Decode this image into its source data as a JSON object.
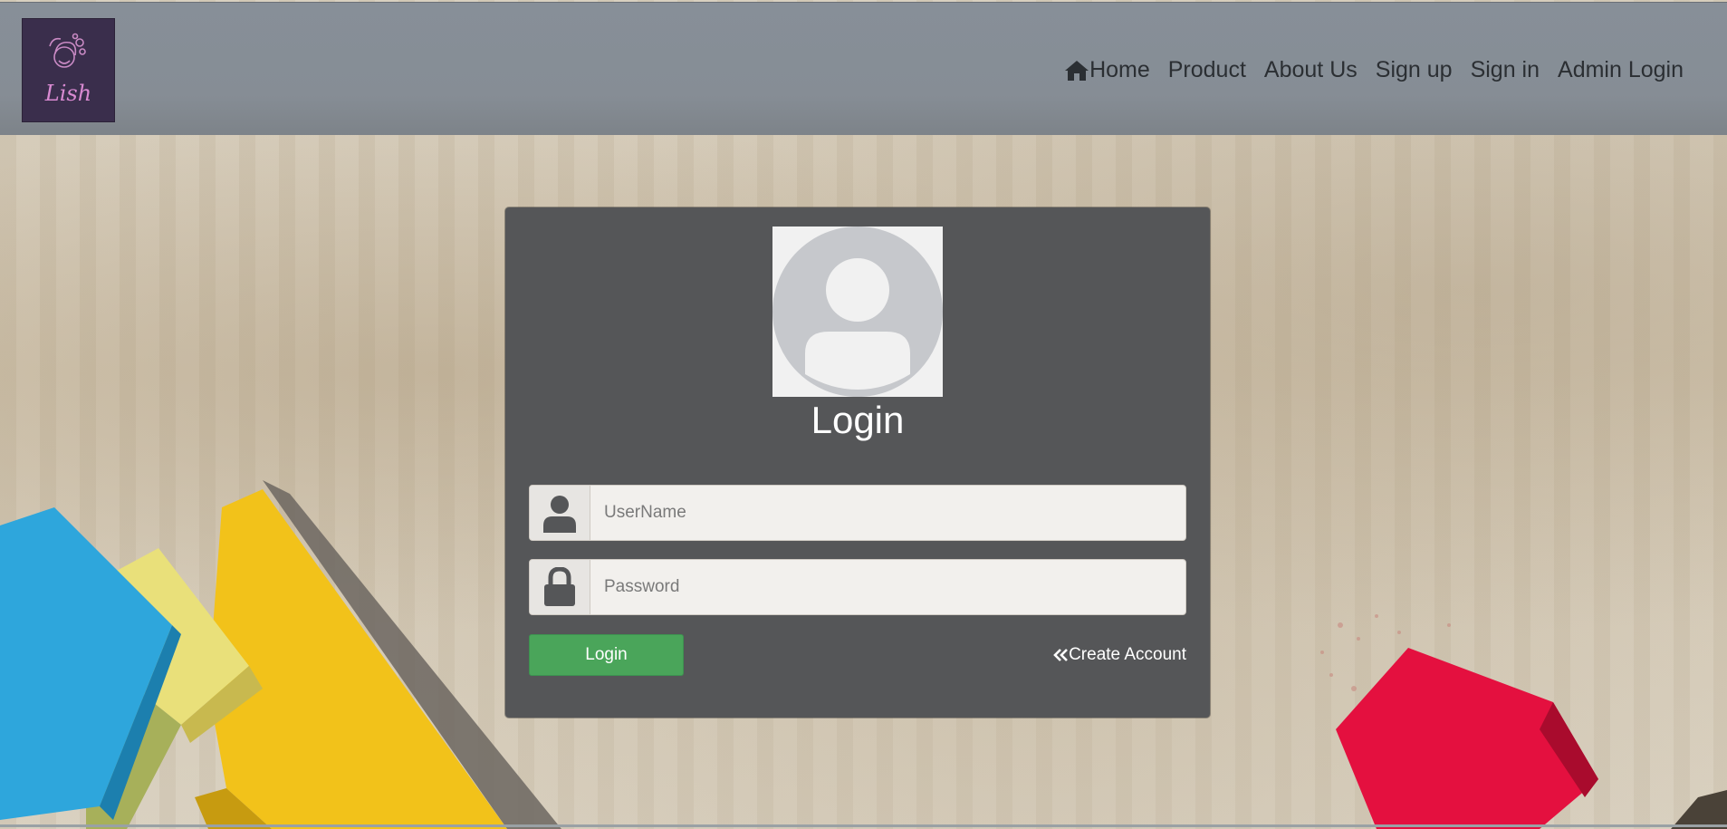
{
  "brand": {
    "logo_text": "Lish",
    "logo_icon": "fairy-face-logo"
  },
  "nav": {
    "home_icon": "home-icon",
    "home": "Home",
    "product": "Product",
    "about": "About Us",
    "signup": "Sign up",
    "signin": "Sign in",
    "admin": "Admin Login"
  },
  "login_card": {
    "avatar_icon": "user-avatar-icon",
    "title": "Login",
    "username": {
      "icon": "user-icon",
      "placeholder": "UserName",
      "value": ""
    },
    "password": {
      "icon": "lock-icon",
      "placeholder": "Password",
      "value": ""
    },
    "login_button": "Login",
    "create_account_icon": "double-chevron-left-icon",
    "create_account": "Create Account"
  },
  "colors": {
    "header": "#878f98",
    "card": "#555658",
    "login_button": "#4aa55a",
    "logo_bg": "#3a2e4c",
    "logo_text": "#d98ad2"
  }
}
